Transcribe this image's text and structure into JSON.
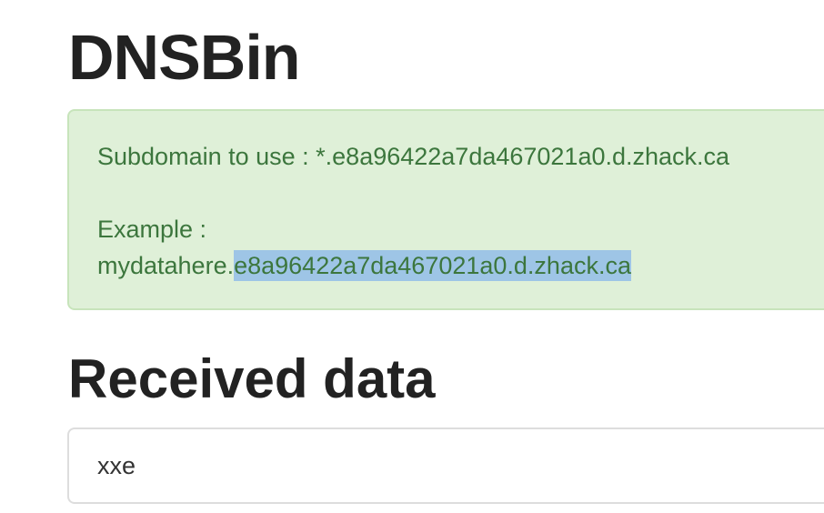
{
  "header": {
    "title": "DNSBin"
  },
  "alert": {
    "subdomain_text": "Subdomain to use : *.e8a96422a7da467021a0.d.zhack.ca",
    "example_label": "Example :",
    "example_prefix": "mydatahere.",
    "example_highlighted": "e8a96422a7da467021a0.d.zhack.ca",
    "background_color": "#dff0d8",
    "text_color": "#3c763d",
    "selection_color": "#9ec5e6"
  },
  "received": {
    "title": "Received data",
    "items": [
      "xxe"
    ]
  }
}
